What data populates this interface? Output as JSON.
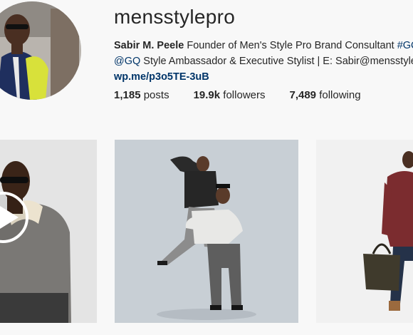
{
  "profile": {
    "username": "mensstylepro",
    "bio_name": "Sabir M. Peele",
    "bio_line1_text": " Founder of Men's Style Pro Brand Consultant ",
    "bio_hashtag": "#GQF",
    "bio_mention": "@GQ",
    "bio_line2_text": " Style Ambassador & Executive Stylist | E: Sabir@mensstylepro",
    "website": "wp.me/p3o5TE-3uB"
  },
  "stats": {
    "posts_count": "1,185",
    "posts_label": "posts",
    "followers_count": "19.9k",
    "followers_label": "followers",
    "following_count": "7,489",
    "following_label": "following"
  },
  "posts": [
    {
      "type": "video",
      "icon": "play-icon"
    },
    {
      "type": "photo"
    },
    {
      "type": "photo"
    }
  ]
}
